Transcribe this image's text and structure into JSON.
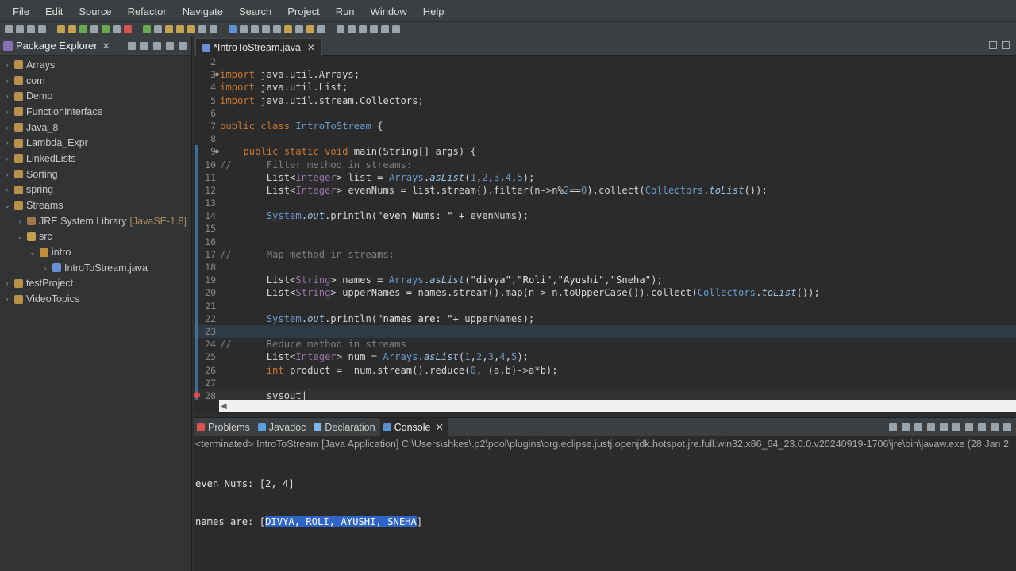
{
  "menubar": [
    "File",
    "Edit",
    "Source",
    "Refactor",
    "Navigate",
    "Search",
    "Project",
    "Run",
    "Window",
    "Help"
  ],
  "explorer": {
    "title": "Package Explorer",
    "items": [
      {
        "label": "Arrays",
        "depth": 0,
        "kind": "project",
        "twisty": "›"
      },
      {
        "label": "com",
        "depth": 0,
        "kind": "project",
        "twisty": "›"
      },
      {
        "label": "Demo",
        "depth": 0,
        "kind": "project",
        "twisty": "›"
      },
      {
        "label": "FunctionInterface",
        "depth": 0,
        "kind": "project",
        "twisty": "›"
      },
      {
        "label": "Java_8",
        "depth": 0,
        "kind": "project",
        "twisty": "›"
      },
      {
        "label": "Lambda_Expr",
        "depth": 0,
        "kind": "project",
        "twisty": "›"
      },
      {
        "label": "LinkedLists",
        "depth": 0,
        "kind": "project",
        "twisty": "›"
      },
      {
        "label": "Sorting",
        "depth": 0,
        "kind": "project",
        "twisty": "›"
      },
      {
        "label": "spring",
        "depth": 0,
        "kind": "project",
        "twisty": "›"
      },
      {
        "label": "Streams",
        "depth": 0,
        "kind": "project",
        "twisty": "⌄"
      },
      {
        "label": "JRE System Library",
        "suffix": "[JavaSE-1.8]",
        "depth": 1,
        "kind": "library",
        "twisty": "›"
      },
      {
        "label": "src",
        "depth": 1,
        "kind": "source",
        "twisty": "⌄"
      },
      {
        "label": "intro",
        "depth": 2,
        "kind": "package",
        "twisty": "⌄"
      },
      {
        "label": "IntroToStream.java",
        "depth": 3,
        "kind": "java",
        "twisty": "›"
      },
      {
        "label": "testProject",
        "depth": 0,
        "kind": "project",
        "twisty": "›"
      },
      {
        "label": "VideoTopics",
        "depth": 0,
        "kind": "project",
        "twisty": "›"
      }
    ]
  },
  "editor": {
    "tab_label": "*IntroToStream.java",
    "lines": [
      {
        "n": "2",
        "html": ""
      },
      {
        "n": "3",
        "fold": true,
        "html": "<span class='kw'>import</span> java.util.Arrays;"
      },
      {
        "n": "4",
        "html": "<span class='kw'>import</span> java.util.List;"
      },
      {
        "n": "5",
        "html": "<span class='kw'>import</span> java.util.stream.Collectors;"
      },
      {
        "n": "6",
        "html": ""
      },
      {
        "n": "7",
        "html": "<span class='kw'>public class</span> <span class='cl'>IntroToStream</span> {"
      },
      {
        "n": "8",
        "html": ""
      },
      {
        "n": "9",
        "fold": true,
        "change": true,
        "html": "    <span class='kw'>public static void</span> main(String[] args) {"
      },
      {
        "n": "10",
        "change": true,
        "html": "<span class='cm'>//      Filter method in streams:</span>"
      },
      {
        "n": "11",
        "change": true,
        "html": "        List&lt;<span class='ty'>Integer</span>&gt; list = <span class='cl'>Arrays</span>.<span class='it'>asList</span>(<span class='nm'>1</span>,<span class='nm'>2</span>,<span class='nm'>3</span>,<span class='nm'>4</span>,<span class='nm'>5</span>);"
      },
      {
        "n": "12",
        "change": true,
        "html": "        List&lt;<span class='ty'>Integer</span>&gt; evenNums = list.stream().filter(n-&gt;n%<span class='nm'>2</span>==<span class='nm'>0</span>).collect(<span class='cl'>Collectors</span>.<span class='it'>toList</span>());"
      },
      {
        "n": "13",
        "change": true,
        "html": ""
      },
      {
        "n": "14",
        "change": true,
        "html": "        <span class='cl'>System</span>.<span class='it'>out</span>.println(<span class='st'>\"even Nums: \"</span> + evenNums);"
      },
      {
        "n": "15",
        "change": true,
        "html": ""
      },
      {
        "n": "16",
        "change": true,
        "html": ""
      },
      {
        "n": "17",
        "change": true,
        "html": "<span class='cm'>//      Map method in streams:</span>"
      },
      {
        "n": "18",
        "change": true,
        "html": ""
      },
      {
        "n": "19",
        "change": true,
        "html": "        List&lt;<span class='ty'>String</span>&gt; names = <span class='cl'>Arrays</span>.<span class='it'>asList</span>(<span class='st'>\"divya\"</span>,<span class='st'>\"Roli\"</span>,<span class='st'>\"Ayushi\"</span>,<span class='st'>\"Sneha\"</span>);"
      },
      {
        "n": "20",
        "change": true,
        "html": "        List&lt;<span class='ty'>String</span>&gt; upperNames = names.stream().map(n-&gt; n.toUpperCase()).collect(<span class='cl'>Collectors</span>.<span class='it'>toList</span>());"
      },
      {
        "n": "21",
        "change": true,
        "html": ""
      },
      {
        "n": "22",
        "change": true,
        "html": "        <span class='cl'>System</span>.<span class='it'>out</span>.println(<span class='st'>\"names are: \"</span>+ upperNames);"
      },
      {
        "n": "23",
        "change": true,
        "hl": true,
        "html": ""
      },
      {
        "n": "24",
        "change": true,
        "html": "<span class='cm'>//      Reduce method in streams</span>"
      },
      {
        "n": "25",
        "change": true,
        "html": "        List&lt;<span class='ty'>Integer</span>&gt; num = <span class='cl'>Arrays</span>.<span class='it'>asList</span>(<span class='nm'>1</span>,<span class='nm'>2</span>,<span class='nm'>3</span>,<span class='nm'>4</span>,<span class='nm'>5</span>);"
      },
      {
        "n": "26",
        "change": true,
        "html": "        <span class='kw'>int</span> product =  num.stream().reduce(<span class='nm'>0</span>, (a,b)-&gt;a*b);"
      },
      {
        "n": "27",
        "change": true,
        "html": ""
      },
      {
        "n": "28",
        "change": true,
        "cur": true,
        "error": true,
        "html": "        sysout|"
      }
    ]
  },
  "console": {
    "tabs": [
      {
        "label": "Problems",
        "color": "#d9534f"
      },
      {
        "label": "Javadoc",
        "color": "#5aa0e0"
      },
      {
        "label": "Declaration",
        "color": "#7fb6e8"
      },
      {
        "label": "Console",
        "color": "#5a8fd0",
        "active": true
      }
    ],
    "status": "<terminated> IntroToStream [Java Application] C:\\Users\\shkes\\.p2\\pool\\plugins\\org.eclipse.justj.openjdk.hotspot.jre.full.win32.x86_64_23.0.0.v20240919-1706\\jre\\bin\\javaw.exe  (28 Jan 2",
    "line1": "even Nums: [2, 4]",
    "line2_prefix": "names are: [",
    "line2_selected": "DIVYA, ROLI, AYUSHI, SNEHA",
    "line2_suffix": "]"
  }
}
